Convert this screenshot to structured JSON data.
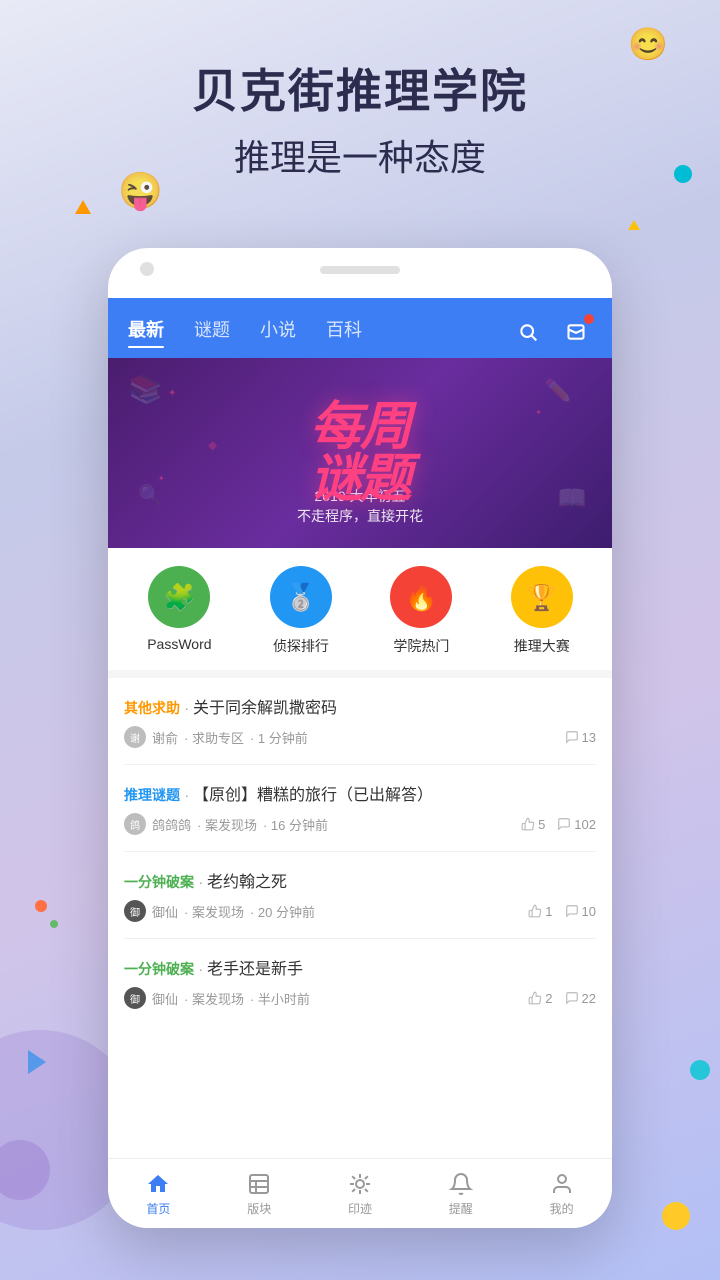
{
  "background": {
    "title1": "贝克街推理学院",
    "subtitle1": "推理是一种态度"
  },
  "nav": {
    "tabs": [
      {
        "label": "最新",
        "active": true
      },
      {
        "label": "谜题",
        "active": false
      },
      {
        "label": "小说",
        "active": false
      },
      {
        "label": "百科",
        "active": false
      }
    ]
  },
  "banner": {
    "line1": "每周",
    "line2": "谜题",
    "sub1": "2019 大年初五",
    "sub2": "不走程序，直接开花"
  },
  "quicklinks": [
    {
      "label": "PassWord",
      "icon": "🧩",
      "color": "icon-green"
    },
    {
      "label": "侦探排行",
      "icon": "🏆",
      "color": "icon-blue"
    },
    {
      "label": "学院热门",
      "icon": "🔥",
      "color": "icon-red"
    },
    {
      "label": "推理大赛",
      "icon": "🏅",
      "color": "icon-yellow"
    }
  ],
  "posts": [
    {
      "category": "其他求助",
      "categoryColor": "color-orange",
      "dot": "·",
      "title": "关于同余解凯撒密码",
      "author": "谢俞",
      "zone": "求助专区",
      "time": "1 分钟前",
      "hasLike": false,
      "likeCount": null,
      "commentCount": 13
    },
    {
      "category": "推理谜题",
      "categoryColor": "color-blue",
      "dot": "·",
      "title": "【原创】糟糕的旅行（已出解答）",
      "author": "鸽鸽鸽",
      "zone": "案发现场",
      "time": "16 分钟前",
      "hasLike": true,
      "likeCount": 5,
      "commentCount": 102
    },
    {
      "category": "一分钟破案",
      "categoryColor": "color-green",
      "dot": "·",
      "title": "老约翰之死",
      "author": "御仙",
      "zone": "案发现场",
      "time": "20 分钟前",
      "hasLike": true,
      "likeCount": 1,
      "commentCount": 10
    },
    {
      "category": "一分钟破案",
      "categoryColor": "color-green",
      "dot": "·",
      "title": "老手还是新手",
      "author": "御仙",
      "zone": "案发现场",
      "time": "半小时前",
      "hasLike": true,
      "likeCount": 2,
      "commentCount": 22
    }
  ],
  "bottomnav": [
    {
      "label": "首页",
      "icon": "home",
      "active": true
    },
    {
      "label": "版块",
      "icon": "grid",
      "active": false
    },
    {
      "label": "印迹",
      "icon": "snowflake",
      "active": false
    },
    {
      "label": "提醒",
      "icon": "bell",
      "active": false
    },
    {
      "label": "我的",
      "icon": "person",
      "active": false
    }
  ]
}
